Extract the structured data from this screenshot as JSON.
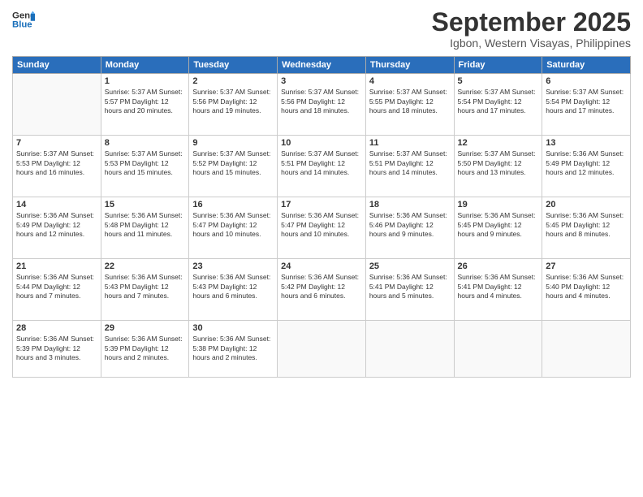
{
  "header": {
    "logo_general": "General",
    "logo_blue": "Blue",
    "month_title": "September 2025",
    "location": "Igbon, Western Visayas, Philippines"
  },
  "weekdays": [
    "Sunday",
    "Monday",
    "Tuesday",
    "Wednesday",
    "Thursday",
    "Friday",
    "Saturday"
  ],
  "weeks": [
    [
      {
        "day": "",
        "info": ""
      },
      {
        "day": "1",
        "info": "Sunrise: 5:37 AM\nSunset: 5:57 PM\nDaylight: 12 hours\nand 20 minutes."
      },
      {
        "day": "2",
        "info": "Sunrise: 5:37 AM\nSunset: 5:56 PM\nDaylight: 12 hours\nand 19 minutes."
      },
      {
        "day": "3",
        "info": "Sunrise: 5:37 AM\nSunset: 5:56 PM\nDaylight: 12 hours\nand 18 minutes."
      },
      {
        "day": "4",
        "info": "Sunrise: 5:37 AM\nSunset: 5:55 PM\nDaylight: 12 hours\nand 18 minutes."
      },
      {
        "day": "5",
        "info": "Sunrise: 5:37 AM\nSunset: 5:54 PM\nDaylight: 12 hours\nand 17 minutes."
      },
      {
        "day": "6",
        "info": "Sunrise: 5:37 AM\nSunset: 5:54 PM\nDaylight: 12 hours\nand 17 minutes."
      }
    ],
    [
      {
        "day": "7",
        "info": "Sunrise: 5:37 AM\nSunset: 5:53 PM\nDaylight: 12 hours\nand 16 minutes."
      },
      {
        "day": "8",
        "info": "Sunrise: 5:37 AM\nSunset: 5:53 PM\nDaylight: 12 hours\nand 15 minutes."
      },
      {
        "day": "9",
        "info": "Sunrise: 5:37 AM\nSunset: 5:52 PM\nDaylight: 12 hours\nand 15 minutes."
      },
      {
        "day": "10",
        "info": "Sunrise: 5:37 AM\nSunset: 5:51 PM\nDaylight: 12 hours\nand 14 minutes."
      },
      {
        "day": "11",
        "info": "Sunrise: 5:37 AM\nSunset: 5:51 PM\nDaylight: 12 hours\nand 14 minutes."
      },
      {
        "day": "12",
        "info": "Sunrise: 5:37 AM\nSunset: 5:50 PM\nDaylight: 12 hours\nand 13 minutes."
      },
      {
        "day": "13",
        "info": "Sunrise: 5:36 AM\nSunset: 5:49 PM\nDaylight: 12 hours\nand 12 minutes."
      }
    ],
    [
      {
        "day": "14",
        "info": "Sunrise: 5:36 AM\nSunset: 5:49 PM\nDaylight: 12 hours\nand 12 minutes."
      },
      {
        "day": "15",
        "info": "Sunrise: 5:36 AM\nSunset: 5:48 PM\nDaylight: 12 hours\nand 11 minutes."
      },
      {
        "day": "16",
        "info": "Sunrise: 5:36 AM\nSunset: 5:47 PM\nDaylight: 12 hours\nand 10 minutes."
      },
      {
        "day": "17",
        "info": "Sunrise: 5:36 AM\nSunset: 5:47 PM\nDaylight: 12 hours\nand 10 minutes."
      },
      {
        "day": "18",
        "info": "Sunrise: 5:36 AM\nSunset: 5:46 PM\nDaylight: 12 hours\nand 9 minutes."
      },
      {
        "day": "19",
        "info": "Sunrise: 5:36 AM\nSunset: 5:45 PM\nDaylight: 12 hours\nand 9 minutes."
      },
      {
        "day": "20",
        "info": "Sunrise: 5:36 AM\nSunset: 5:45 PM\nDaylight: 12 hours\nand 8 minutes."
      }
    ],
    [
      {
        "day": "21",
        "info": "Sunrise: 5:36 AM\nSunset: 5:44 PM\nDaylight: 12 hours\nand 7 minutes."
      },
      {
        "day": "22",
        "info": "Sunrise: 5:36 AM\nSunset: 5:43 PM\nDaylight: 12 hours\nand 7 minutes."
      },
      {
        "day": "23",
        "info": "Sunrise: 5:36 AM\nSunset: 5:43 PM\nDaylight: 12 hours\nand 6 minutes."
      },
      {
        "day": "24",
        "info": "Sunrise: 5:36 AM\nSunset: 5:42 PM\nDaylight: 12 hours\nand 6 minutes."
      },
      {
        "day": "25",
        "info": "Sunrise: 5:36 AM\nSunset: 5:41 PM\nDaylight: 12 hours\nand 5 minutes."
      },
      {
        "day": "26",
        "info": "Sunrise: 5:36 AM\nSunset: 5:41 PM\nDaylight: 12 hours\nand 4 minutes."
      },
      {
        "day": "27",
        "info": "Sunrise: 5:36 AM\nSunset: 5:40 PM\nDaylight: 12 hours\nand 4 minutes."
      }
    ],
    [
      {
        "day": "28",
        "info": "Sunrise: 5:36 AM\nSunset: 5:39 PM\nDaylight: 12 hours\nand 3 minutes."
      },
      {
        "day": "29",
        "info": "Sunrise: 5:36 AM\nSunset: 5:39 PM\nDaylight: 12 hours\nand 2 minutes."
      },
      {
        "day": "30",
        "info": "Sunrise: 5:36 AM\nSunset: 5:38 PM\nDaylight: 12 hours\nand 2 minutes."
      },
      {
        "day": "",
        "info": ""
      },
      {
        "day": "",
        "info": ""
      },
      {
        "day": "",
        "info": ""
      },
      {
        "day": "",
        "info": ""
      }
    ]
  ]
}
